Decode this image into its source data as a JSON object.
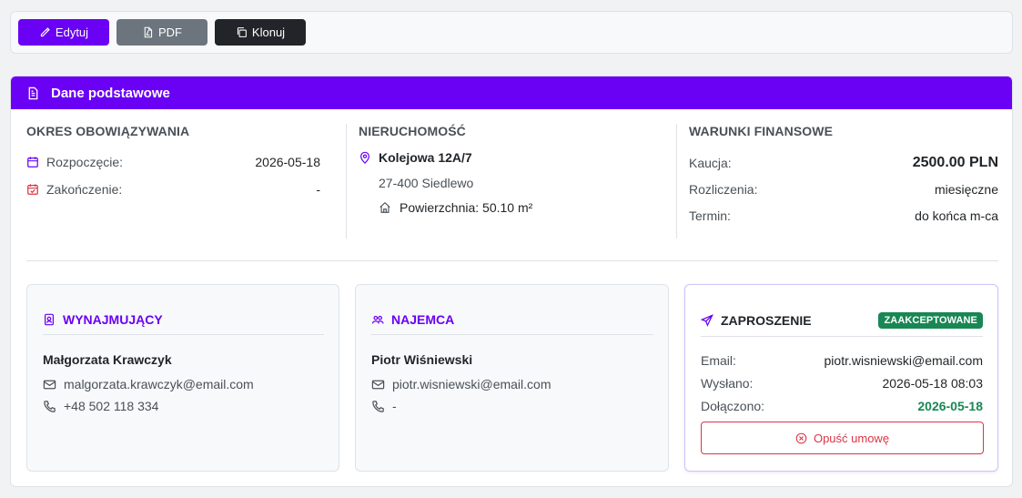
{
  "toolbar": {
    "edit_label": "Edytuj",
    "pdf_label": "PDF",
    "clone_label": "Klonuj"
  },
  "card": {
    "title": "Dane podstawowe"
  },
  "term": {
    "title": "OKRES OBOWIĄZYWANIA",
    "start_label": "Rozpoczęcie:",
    "start_value": "2026-05-18",
    "end_label": "Zakończenie:",
    "end_value": "-"
  },
  "property": {
    "title": "NIERUCHOMOŚĆ",
    "address": "Kolejowa 12A/7",
    "city": "27-400 Siedlewo",
    "area": "Powierzchnia: 50.10 m²"
  },
  "finance": {
    "title": "WARUNKI FINANSOWE",
    "deposit_label": "Kaucja:",
    "deposit_value": "2500.00 PLN",
    "billing_label": "Rozliczenia:",
    "billing_value": "miesięczne",
    "due_label": "Termin:",
    "due_value": "do końca m-ca"
  },
  "landlord": {
    "title": "WYNAJMUJĄCY",
    "name": "Małgorzata Krawczyk",
    "email": "malgorzata.krawczyk@email.com",
    "phone": "+48 502 118 334"
  },
  "tenant": {
    "title": "NAJEMCA",
    "name": "Piotr Wiśniewski",
    "email": "piotr.wisniewski@email.com",
    "phone": "-"
  },
  "invitation": {
    "title": "ZAPROSZENIE",
    "status": "ZAAKCEPTOWANE",
    "email_label": "Email:",
    "email_value": "piotr.wisniewski@email.com",
    "sent_label": "Wysłano:",
    "sent_value": "2026-05-18 08:03",
    "joined_label": "Dołączono:",
    "joined_value": "2026-05-18",
    "leave_label": "Opuść umowę"
  },
  "colors": {
    "accent": "#6a00f4",
    "success": "#198754",
    "danger": "#dc3545"
  }
}
